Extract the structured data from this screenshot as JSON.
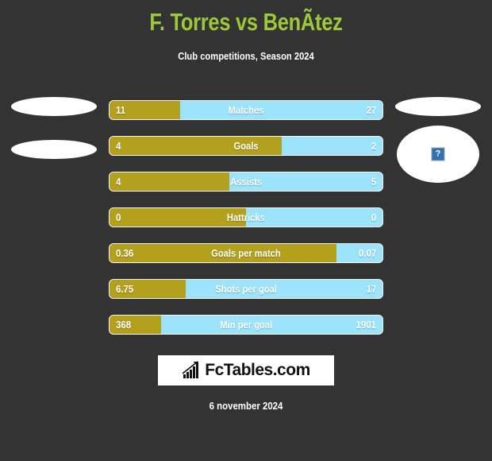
{
  "header": {
    "title": "F. Torres vs BenÃtez",
    "subtitle": "Club competitions, Season 2024",
    "title_color": "#9ec73a",
    "subtitle_color": "#ffffff"
  },
  "colors": {
    "background": "#333333",
    "home_bar": "#b3a11d",
    "away_bar": "#9ce4fb",
    "row_border": "#f2f2f2",
    "text": "#ffffff"
  },
  "players": {
    "home": {
      "photo_state": "missing",
      "photo_placeholder_icon": "broken-image-icon"
    },
    "away": {
      "photo_state": "missing",
      "photo_placeholder_icon": "broken-image-icon",
      "placeholder_glyph": "?"
    }
  },
  "stats": [
    {
      "label": "Matches",
      "home": "11",
      "away": "27",
      "home_pct": 26
    },
    {
      "label": "Goals",
      "home": "4",
      "away": "2",
      "home_pct": 63
    },
    {
      "label": "Assists",
      "home": "4",
      "away": "5",
      "home_pct": 44
    },
    {
      "label": "Hattricks",
      "home": "0",
      "away": "0",
      "home_pct": 50
    },
    {
      "label": "Goals per match",
      "home": "0.36",
      "away": "0.07",
      "home_pct": 83
    },
    {
      "label": "Shots per goal",
      "home": "6.75",
      "away": "17",
      "home_pct": 28
    },
    {
      "label": "Min per goal",
      "home": "368",
      "away": "1901",
      "home_pct": 19
    }
  ],
  "footer": {
    "logo_text": "FcTables.com",
    "logo_icon": "bar-chart-growth-icon",
    "date": "6 november 2024"
  }
}
